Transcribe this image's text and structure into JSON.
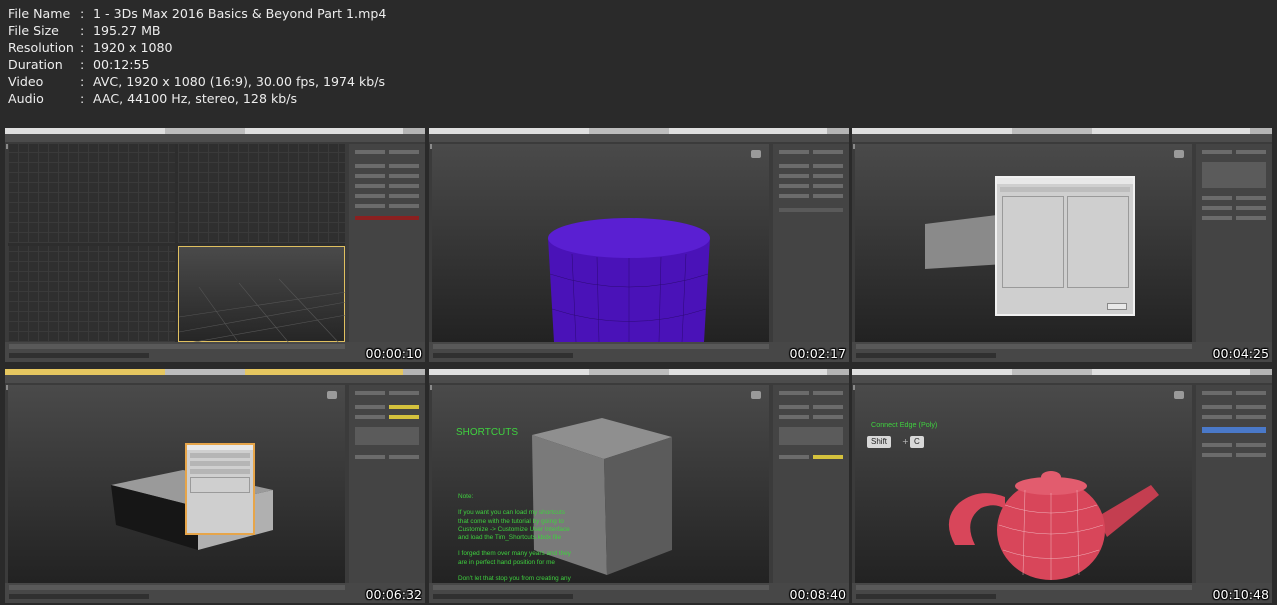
{
  "file_info": [
    {
      "key": "File Name",
      "value": "1 - 3Ds Max 2016 Basics & Beyond Part 1.mp4"
    },
    {
      "key": "File Size",
      "value": "195.27 MB"
    },
    {
      "key": "Resolution",
      "value": "1920 x 1080"
    },
    {
      "key": "Duration",
      "value": "00:12:55"
    },
    {
      "key": "Video",
      "value": "AVC, 1920 x 1080 (16:9), 30.00 fps, 1974 kb/s"
    },
    {
      "key": "Audio",
      "value": "AAC, 44100 Hz, stereo, 128 kb/s"
    }
  ],
  "separator": ":",
  "thumbnails": [
    {
      "timestamp": "00:00:10"
    },
    {
      "timestamp": "00:02:17"
    },
    {
      "timestamp": "00:04:25"
    },
    {
      "timestamp": "00:06:32"
    },
    {
      "timestamp": "00:08:40"
    },
    {
      "timestamp": "00:10:48"
    }
  ],
  "frame5": {
    "heading": "SHORTCUTS",
    "note": "Note:\n\nIf you want you can load my shortcuts\nthat come with the tutorial by going to\nCustomize -> Customize User Interface\nand load the Tim_Shortcuts.kbdx file\n\nI forged them over many years and they\nare in perfect hand position for me\n\nDon't let that stop you from creating any\nthat work best for you!"
  },
  "frame6": {
    "caption": "Connect Edge (Poly)",
    "key1": "Shift",
    "plus": "+",
    "key2": "C"
  },
  "colors": {
    "cylinder": "#4a12b8",
    "teapot": "#d8465a",
    "overlay_text": "#3fd13f"
  }
}
